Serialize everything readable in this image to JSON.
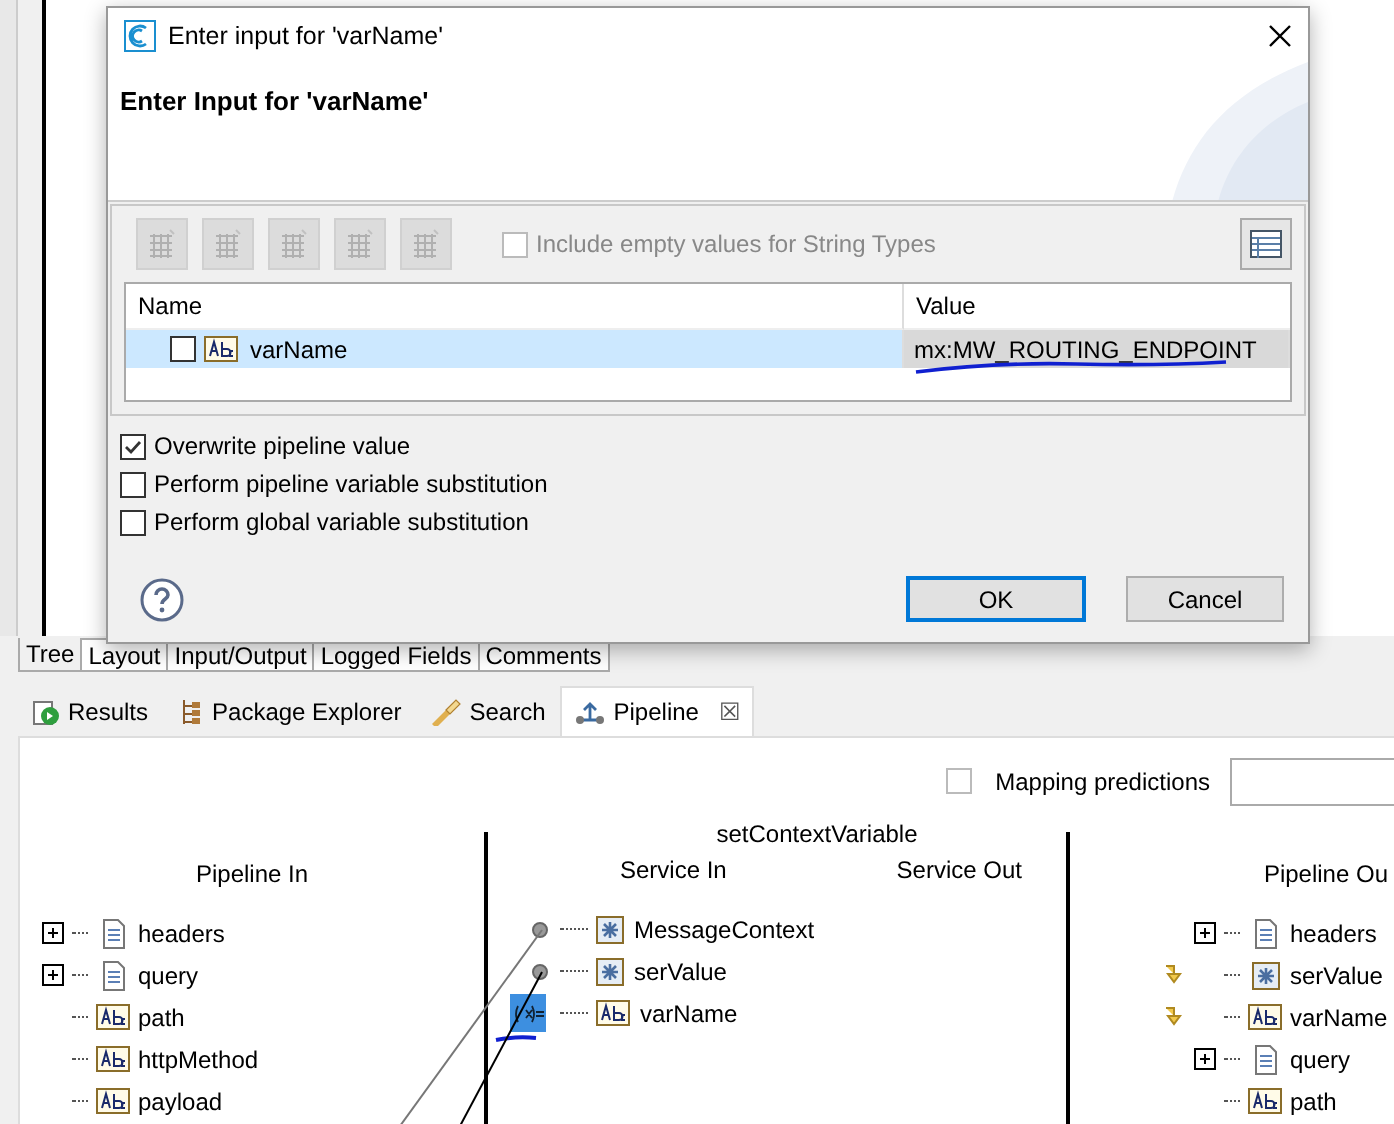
{
  "dialog": {
    "title": "Enter input for 'varName'",
    "heading": "Enter Input for 'varName'",
    "toolbar_option": {
      "label": "Include empty values for String Types",
      "checked": false,
      "disabled": true
    },
    "columns": [
      "Name",
      "Value"
    ],
    "rows": [
      {
        "name": "varName",
        "kind": "string",
        "checked": false,
        "selected": true,
        "value": "mx:MW_ROUTING_ENDPOINT"
      }
    ],
    "options": [
      {
        "label": "Overwrite pipeline value",
        "checked": true
      },
      {
        "label": "Perform pipeline variable substitution",
        "checked": false
      },
      {
        "label": "Perform global variable substitution",
        "checked": false
      }
    ],
    "buttons": [
      {
        "label": "OK",
        "default": true
      },
      {
        "label": "Cancel",
        "default": false
      }
    ]
  },
  "editor_tabs": [
    {
      "label": "Tree",
      "selected": true
    },
    {
      "label": "Layout",
      "selected": false
    },
    {
      "label": "Input/Output",
      "selected": false
    },
    {
      "label": "Logged Fields",
      "selected": false
    },
    {
      "label": "Comments",
      "selected": false
    }
  ],
  "views": [
    {
      "label": "Results",
      "kind": "results",
      "selected": false
    },
    {
      "label": "Package Explorer",
      "kind": "packages",
      "selected": false
    },
    {
      "label": "Search",
      "kind": "search",
      "selected": false
    },
    {
      "label": "Pipeline",
      "kind": "pipeline",
      "selected": true,
      "close": "☒"
    }
  ],
  "pipeline": {
    "mapping_predictions": {
      "label": "Mapping predictions",
      "checked": false
    },
    "pipeline_in": {
      "title": "Pipeline In",
      "items": [
        {
          "name": "headers",
          "kind": "document",
          "expandable": true
        },
        {
          "name": "query",
          "kind": "document",
          "expandable": true
        },
        {
          "name": "path",
          "kind": "string",
          "expandable": false
        },
        {
          "name": "httpMethod",
          "kind": "string",
          "expandable": false
        },
        {
          "name": "payload",
          "kind": "string",
          "expandable": false
        }
      ]
    },
    "service": {
      "name": "setContextVariable",
      "in_title": "Service In",
      "out_title": "Service Out",
      "inputs": [
        {
          "name": "MessageContext",
          "kind": "object",
          "linked": true
        },
        {
          "name": "serValue",
          "kind": "object",
          "linked": true
        },
        {
          "name": "varName",
          "kind": "string",
          "linked": false
        }
      ]
    },
    "pipeline_out": {
      "title": "Pipeline Ou",
      "items": [
        {
          "name": "headers",
          "kind": "document",
          "expandable": true,
          "mapped": false
        },
        {
          "name": "serValue",
          "kind": "object",
          "expandable": false,
          "mapped": true
        },
        {
          "name": "varName",
          "kind": "string",
          "expandable": false,
          "mapped": true
        },
        {
          "name": "query",
          "kind": "document",
          "expandable": true,
          "mapped": false
        },
        {
          "name": "path",
          "kind": "string",
          "expandable": false,
          "mapped": false
        }
      ]
    }
  }
}
